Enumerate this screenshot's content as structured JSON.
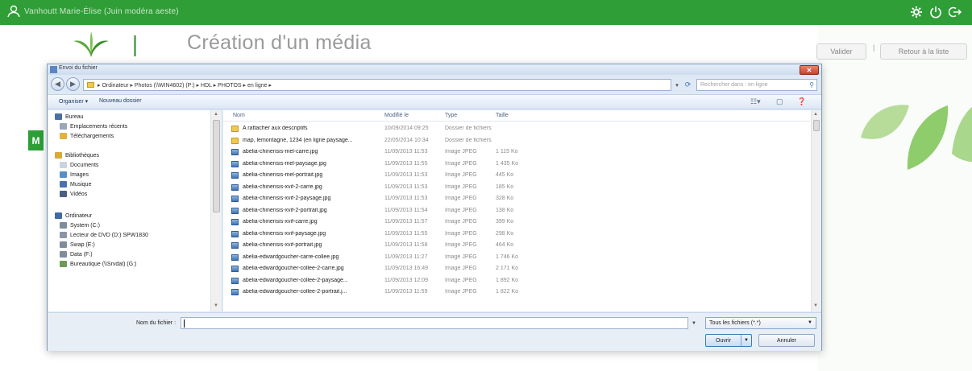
{
  "topbar": {
    "user_label": "Vanhoutt Marie-Élise (Juin modéra aeste)",
    "icons": [
      "user-icon",
      "settings-gear-icon",
      "power-icon",
      "logout-icon"
    ]
  },
  "app": {
    "title": "Création d'un média",
    "validate_label": "Valider",
    "separator": "|",
    "back_label": "Retour à la liste",
    "side_tab": "M"
  },
  "dialog": {
    "title": "Envoi du fichier",
    "close_label": "✕",
    "breadcrumb": "▸ Ordinateur ▸ Photos (\\\\WIN4602) (P:) ▸ HDL ▸ PHOTOS ▸ en ligne ▸",
    "search_placeholder": "Rechercher dans : en ligne",
    "organize_label": "Organiser ▾",
    "new_folder_label": "Nouveau dossier",
    "columns": {
      "name": "Nom",
      "date": "Modifié le",
      "type": "Type",
      "size": "Taille"
    },
    "nav_items": [
      {
        "label": "Bureau",
        "icon": "desktop-icon",
        "color": "#4a6fa5"
      },
      {
        "label": "Emplacements récents",
        "icon": "recent-places-icon",
        "color": "#9aa7b8"
      },
      {
        "label": "Téléchargements",
        "icon": "downloads-icon",
        "color": "#e2b23a"
      },
      {
        "label": "Bibliothèques",
        "icon": "libraries-icon",
        "color": "#d9a93a"
      },
      {
        "label": "Documents",
        "icon": "documents-icon",
        "color": "#c9d4e3"
      },
      {
        "label": "Images",
        "icon": "images-icon",
        "color": "#5b8ec9"
      },
      {
        "label": "Musique",
        "icon": "music-icon",
        "color": "#4b6fb0"
      },
      {
        "label": "Vidéos",
        "icon": "videos-icon",
        "color": "#4a5f82"
      },
      {
        "label": "Ordinateur",
        "icon": "computer-icon",
        "color": "#3f6aa7"
      },
      {
        "label": "System (C:)",
        "icon": "drive-icon",
        "color": "#7f8c9c"
      },
      {
        "label": "Lecteur de DVD (D:) SPW1830",
        "icon": "dvd-drive-icon",
        "color": "#8a96a6"
      },
      {
        "label": "Swap (E:)",
        "icon": "drive-icon",
        "color": "#7f8c9c"
      },
      {
        "label": "Data (F:)",
        "icon": "drive-icon",
        "color": "#7f8c9c"
      },
      {
        "label": "Bureautique (\\\\Srvdat) (G:)",
        "icon": "network-drive-icon",
        "color": "#6f9a55"
      }
    ],
    "files": [
      {
        "name": "A rattacher aux descriptifs",
        "date": "10/09/2014 09:25",
        "type": "Dossier de fichiers",
        "size": "",
        "folder": true
      },
      {
        "name": "map, lemontagne, 1234 (en ligne paysage...",
        "date": "22/05/2014 10:34",
        "type": "Dossier de fichiers",
        "size": "",
        "folder": true
      },
      {
        "name": "abelia-chinensis-mel-carre.jpg",
        "date": "11/09/2013 11:53",
        "type": "Image JPEG",
        "size": "1 115 Ko",
        "folder": false
      },
      {
        "name": "abelia-chinensis-mel-paysage.jpg",
        "date": "11/09/2013 11:55",
        "type": "Image JPEG",
        "size": "1 435 Ko",
        "folder": false
      },
      {
        "name": "abelia-chinensis-mel-portrait.jpg",
        "date": "11/09/2013 11:53",
        "type": "Image JPEG",
        "size": "445 Ko",
        "folder": false
      },
      {
        "name": "abelia-chinensis-xvif-2-carre.jpg",
        "date": "11/09/2013 11:53",
        "type": "Image JPEG",
        "size": "185 Ko",
        "folder": false
      },
      {
        "name": "abelia-chinensis-xvif-2-paysage.jpg",
        "date": "11/09/2013 11:53",
        "type": "Image JPEG",
        "size": "328 Ko",
        "folder": false
      },
      {
        "name": "abelia-chinensis-xvif-2-portrait.jpg",
        "date": "11/09/2013 11:54",
        "type": "Image JPEG",
        "size": "138 Ko",
        "folder": false
      },
      {
        "name": "abelia-chinensis-xvif-carre.jpg",
        "date": "11/09/2013 11:57",
        "type": "Image JPEG",
        "size": "399 Ko",
        "folder": false
      },
      {
        "name": "abelia-chinensis-xvif-paysage.jpg",
        "date": "11/09/2013 11:55",
        "type": "Image JPEG",
        "size": "298 Ko",
        "folder": false
      },
      {
        "name": "abelia-chinensis-xvif-portrait.jpg",
        "date": "11/09/2013 11:58",
        "type": "Image JPEG",
        "size": "464 Ko",
        "folder": false
      },
      {
        "name": "abelia-edwardgoucher-carre-collee.jpg",
        "date": "11/09/2013 11:27",
        "type": "Image JPEG",
        "size": "1 746 Ko",
        "folder": false
      },
      {
        "name": "abelia-edwardgoucher-collee-2-carre.jpg",
        "date": "11/09/2013 16:49",
        "type": "Image JPEG",
        "size": "2 171 Ko",
        "folder": false
      },
      {
        "name": "abelia-edwardgoucher-collee-2-paysage...",
        "date": "11/09/2013 12:09",
        "type": "Image JPEG",
        "size": "1 892 Ko",
        "folder": false
      },
      {
        "name": "abelia-edwardgoucher-collee-2-portrait.j...",
        "date": "11/09/2013 11:59",
        "type": "Image JPEG",
        "size": "1 822 Ko",
        "folder": false
      }
    ],
    "filename_label": "Nom du fichier :",
    "filename_value": "",
    "filetype_value": "Tous les fichiers (*.*)",
    "open_label": "Ouvrir",
    "cancel_label": "Annuler"
  },
  "colors": {
    "brand_green": "#2f9e37",
    "dialog_bg": "#dfe9f5"
  }
}
